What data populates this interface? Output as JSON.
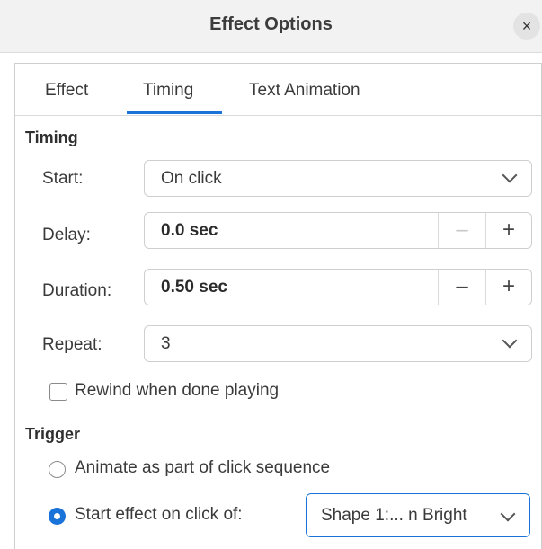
{
  "window": {
    "title": "Effect Options",
    "close_symbol": "×"
  },
  "tabs": [
    {
      "label": "Effect",
      "active": false
    },
    {
      "label": "Timing",
      "active": true
    },
    {
      "label": "Text Animation",
      "active": false
    }
  ],
  "accent_color": "#1a73d8",
  "timing": {
    "section_title": "Timing",
    "start": {
      "label": "Start:",
      "value": "On click"
    },
    "delay": {
      "label": "Delay:",
      "value": "0.0 sec",
      "minus": "–",
      "plus": "+"
    },
    "duration": {
      "label": "Duration:",
      "value": "0.50 sec",
      "minus": "–",
      "plus": "+"
    },
    "repeat": {
      "label": "Repeat:",
      "value": "3"
    },
    "rewind": {
      "label": "Rewind when done playing",
      "checked": false
    }
  },
  "trigger": {
    "section_title": "Trigger",
    "option_sequence": {
      "label": "Animate as part of click sequence",
      "selected": false
    },
    "option_click": {
      "label": "Start effect on click of:",
      "selected": true
    },
    "shape_value": "Shape 1:... n Bright"
  }
}
